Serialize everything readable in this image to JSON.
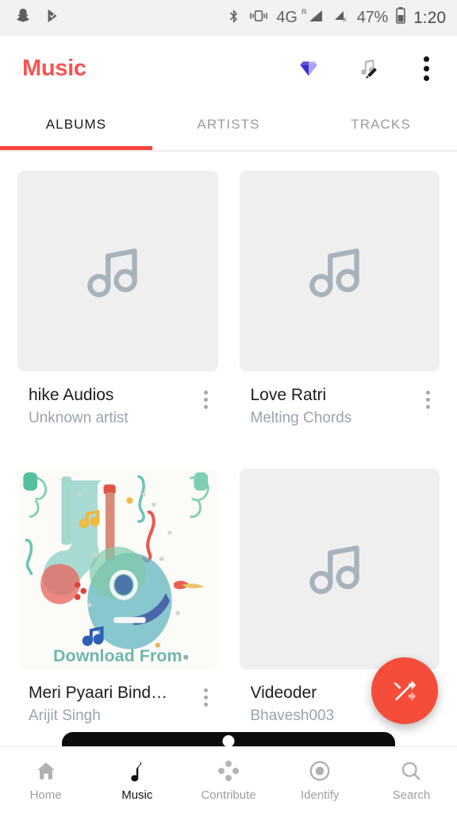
{
  "status_bar": {
    "left_icons": [
      "snapchat-ghost-icon",
      "check-flag-icon"
    ],
    "bluetooth": "bluetooth-icon",
    "vibrate": "vibrate-icon",
    "network_type": "4G",
    "roaming_badge": "R",
    "sim2_no_service": "x",
    "battery_percent": "47%",
    "battery_icon": "battery-icon",
    "clock": "1:20"
  },
  "app_bar": {
    "title": "Music",
    "actions": [
      {
        "name": "premium-gem-icon",
        "label": "Premium"
      },
      {
        "name": "playlist-edit-icon",
        "label": "Edit playlist"
      },
      {
        "name": "overflow-menu-icon",
        "label": "More options"
      }
    ]
  },
  "tabs": {
    "items": [
      {
        "label": "ALBUMS",
        "active": true
      },
      {
        "label": "ARTISTS",
        "active": false
      },
      {
        "label": "TRACKS",
        "active": false
      }
    ],
    "active_index": 0,
    "indicator_color": "#F4453C"
  },
  "albums": [
    {
      "title": "hike Audios",
      "artist": "Unknown artist",
      "art": "placeholder",
      "menu": "album-overflow-icon"
    },
    {
      "title": "Love Ratri",
      "artist": "Melting Chords",
      "art": "placeholder",
      "menu": "album-overflow-icon"
    },
    {
      "title": "Meri Pyaari Bind…",
      "artist": "Arijit Singh",
      "art": "guitars-artwork",
      "art_caption": "Download From",
      "menu": "album-overflow-icon"
    },
    {
      "title": "Videoder",
      "artist": "Bhavesh003",
      "art": "placeholder",
      "menu": "album-overflow-icon"
    }
  ],
  "fab": {
    "name": "shuffle-fab",
    "icon": "shuffle-icon",
    "color": "#F64C3A"
  },
  "bottom_nav": {
    "items": [
      {
        "label": "Home",
        "icon": "home-icon",
        "active": false
      },
      {
        "label": "Music",
        "icon": "music-note-icon",
        "active": true
      },
      {
        "label": "Contribute",
        "icon": "contribute-dots-icon",
        "active": false
      },
      {
        "label": "Identify",
        "icon": "identify-target-icon",
        "active": false
      },
      {
        "label": "Search",
        "icon": "search-icon",
        "active": false
      }
    ]
  },
  "theme": {
    "accent": "#FB5252",
    "tab_indicator": "#F4453C",
    "fab": "#F64C3A",
    "placeholder_bg": "#EFEFEF",
    "secondary_text": "#9aa3ab"
  }
}
